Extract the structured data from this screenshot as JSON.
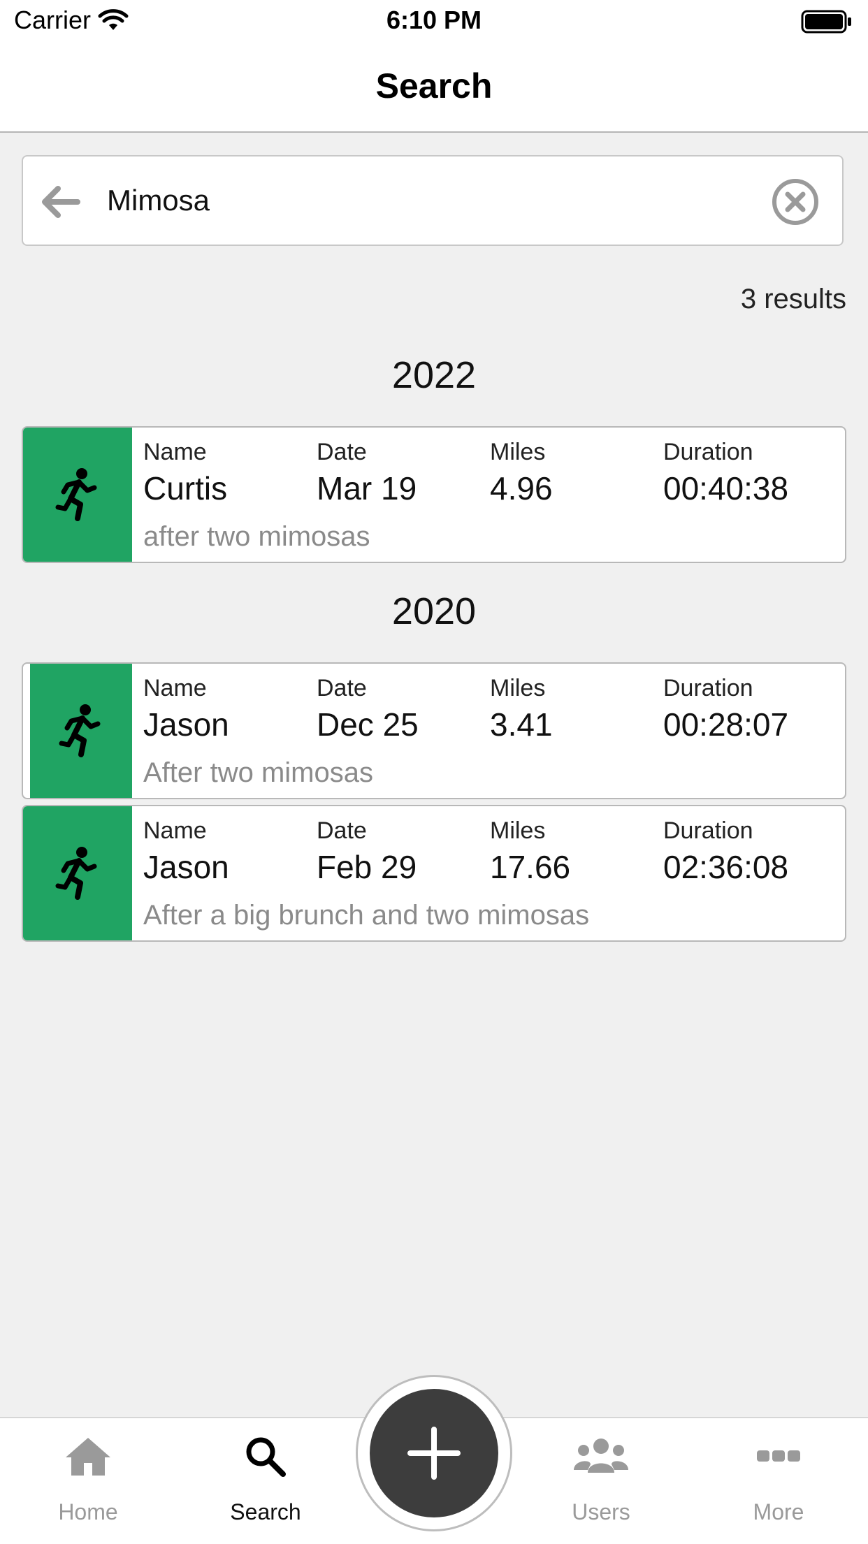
{
  "status_bar": {
    "carrier": "Carrier",
    "time": "6:10 PM"
  },
  "nav": {
    "title": "Search"
  },
  "search": {
    "value": "Mimosa",
    "results_text": "3 results"
  },
  "labels": {
    "name": "Name",
    "date": "Date",
    "miles": "Miles",
    "duration": "Duration"
  },
  "groups": [
    {
      "year": "2022",
      "entries": [
        {
          "name": "Curtis",
          "date": "Mar 19",
          "miles": "4.96",
          "duration": "00:40:38",
          "note": "after two mimosas"
        }
      ]
    },
    {
      "year": "2020",
      "entries": [
        {
          "name": "Jason",
          "date": "Dec 25",
          "miles": "3.41",
          "duration": "00:28:07",
          "note": "After two mimosas"
        },
        {
          "name": "Jason",
          "date": "Feb 29",
          "miles": "17.66",
          "duration": "02:36:08",
          "note": "After a big brunch and two mimosas"
        }
      ]
    }
  ],
  "tabs": [
    {
      "label": "Home",
      "icon": "home-icon",
      "active": false
    },
    {
      "label": "Search",
      "icon": "search-icon",
      "active": true
    },
    {
      "label": "Users",
      "icon": "users-icon",
      "active": false
    },
    {
      "label": "More",
      "icon": "more-icon",
      "active": false
    }
  ],
  "colors": {
    "accent_green": "#20a463",
    "fab": "#3d3d3d"
  }
}
